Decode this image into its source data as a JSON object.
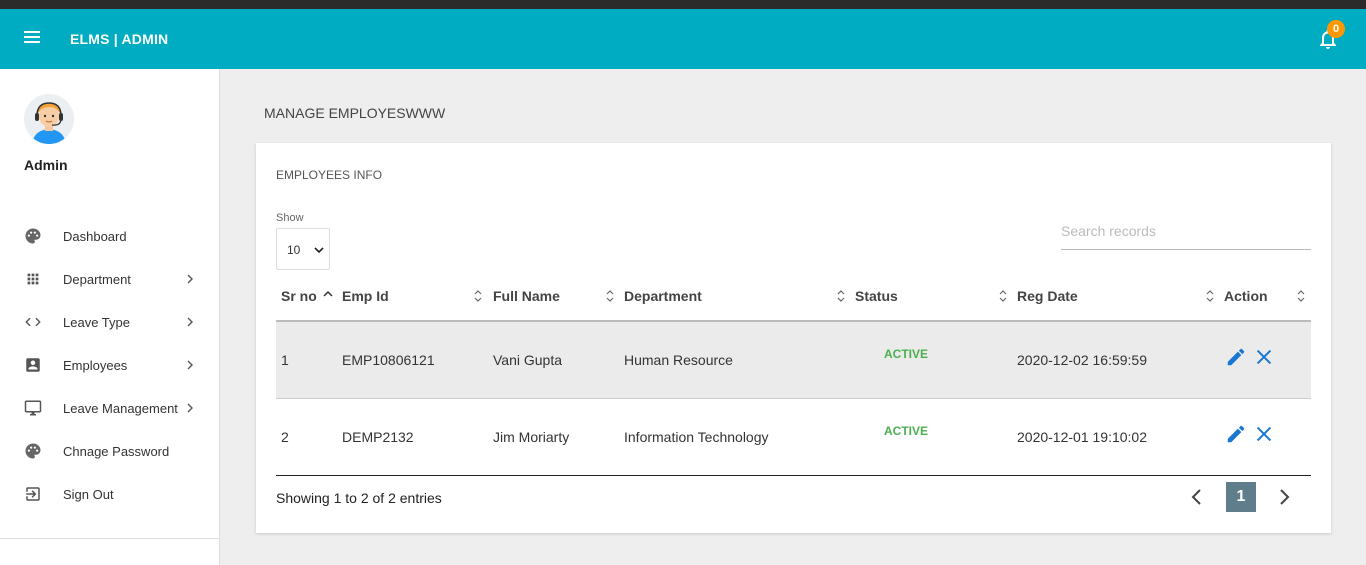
{
  "header": {
    "brand": "ELMS | ADMIN",
    "notification_count": "0"
  },
  "sidebar": {
    "user_name": "Admin",
    "items": [
      {
        "label": "Dashboard",
        "icon": "palette-icon",
        "has_chevron": false
      },
      {
        "label": "Department",
        "icon": "apps-grid-icon",
        "has_chevron": true
      },
      {
        "label": "Leave Type",
        "icon": "code-icon",
        "has_chevron": true
      },
      {
        "label": "Employees",
        "icon": "account-box-icon",
        "has_chevron": true
      },
      {
        "label": "Leave Management",
        "icon": "monitor-icon",
        "has_chevron": true
      },
      {
        "label": "Chnage Password",
        "icon": "palette-icon",
        "has_chevron": false
      },
      {
        "label": "Sign Out",
        "icon": "exit-icon",
        "has_chevron": false
      }
    ]
  },
  "page": {
    "title": "MANAGE EMPLOYESWWW"
  },
  "card": {
    "title": "EMPLOYEES INFO",
    "show_label": "Show",
    "show_value": "10",
    "search_placeholder": "Search records",
    "columns": [
      "Sr no",
      "Emp Id",
      "Full Name",
      "Department",
      "Status",
      "Reg Date",
      "Action"
    ],
    "rows": [
      {
        "sr": "1",
        "emp_id": "EMP10806121",
        "name": "Vani Gupta",
        "department": "Human Resource",
        "status": "ACTIVE",
        "reg_date": "2020-12-02 16:59:59"
      },
      {
        "sr": "2",
        "emp_id": "DEMP2132",
        "name": "Jim Moriarty",
        "department": "Information Technology",
        "status": "ACTIVE",
        "reg_date": "2020-12-01 19:10:02"
      }
    ],
    "info": "Showing 1 to 2 of 2 entries",
    "current_page": "1"
  },
  "colors": {
    "header": "#00acc1",
    "status_active": "#4caf50",
    "action_icon": "#1976d2",
    "badge": "#ff9800",
    "page_button": "#607d8b"
  }
}
